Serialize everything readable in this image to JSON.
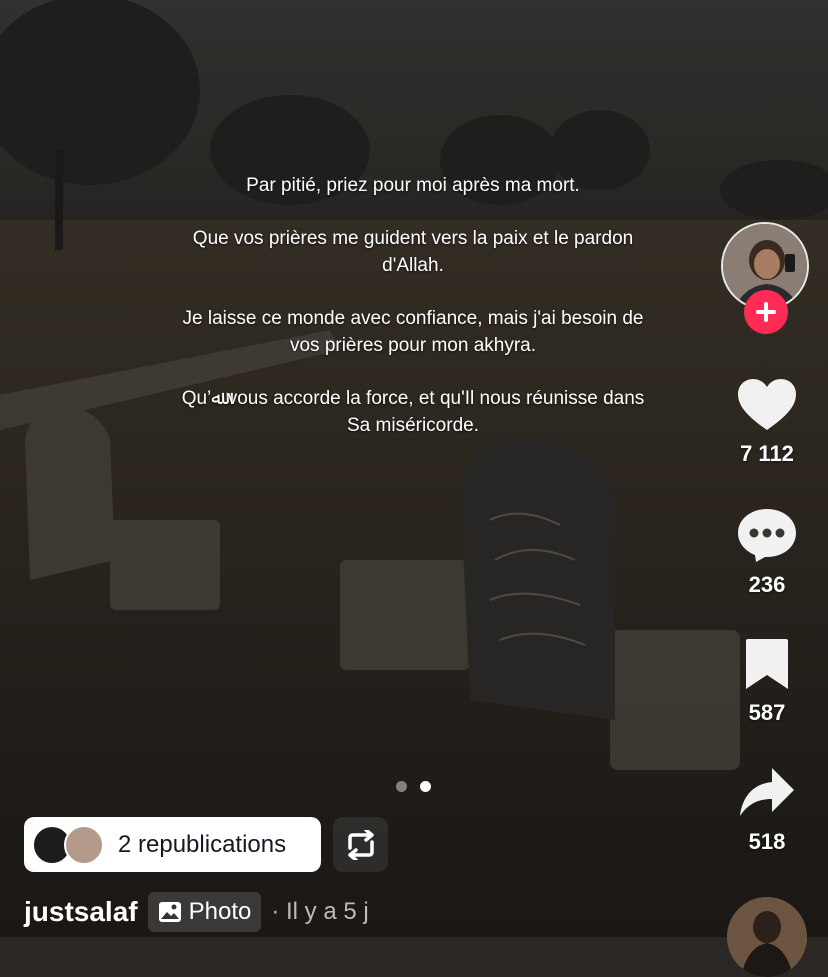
{
  "caption": {
    "p1": "Par pitié, priez pour moi après ma mort.",
    "p2": "Que vos prières me guident vers la paix et le pardon d'Allah.",
    "p3": "Je laisse ce monde avec confiance, mais j'ai besoin de vos prières pour mon akhyra.",
    "p4": "Qu’ﷲ  vous accorde la force, et qu'Il nous réunisse dans Sa miséricorde."
  },
  "actions": {
    "likes": "7 112",
    "comments": "236",
    "saves": "587",
    "shares": "518"
  },
  "carousel": {
    "total_pages": 2,
    "current_page": 2
  },
  "repost": {
    "label": "2 republications"
  },
  "author": {
    "username": "justsalaf",
    "type_label": "Photo",
    "time": "· Il y a 5 j"
  },
  "colors": {
    "follow": "#fe2c55",
    "text": "#ffffff"
  },
  "icons": [
    "plus-icon",
    "heart-icon",
    "comment-icon",
    "bookmark-icon",
    "share-icon",
    "repost-icon",
    "photo-icon"
  ]
}
